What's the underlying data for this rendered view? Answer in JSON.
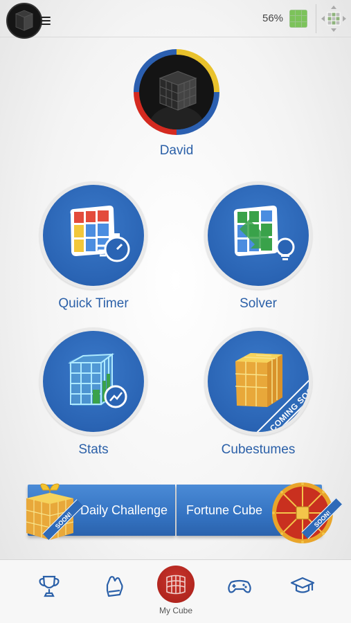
{
  "status": {
    "battery_percent": "56%"
  },
  "profile": {
    "name": "David"
  },
  "features": [
    {
      "label": "Quick Timer"
    },
    {
      "label": "Solver"
    },
    {
      "label": "Stats"
    },
    {
      "label": "Cubestumes",
      "ribbon": "COMING SOON!"
    }
  ],
  "challenges": {
    "daily": {
      "label": "Daily Challenge",
      "badge": "SOON!"
    },
    "fortune": {
      "label": "Fortune Cube",
      "badge": "SOON!"
    }
  },
  "tabs": [
    {
      "icon": "trophy-icon"
    },
    {
      "icon": "glove-icon"
    },
    {
      "icon": "cube-icon",
      "label": "My Cube",
      "active": true
    },
    {
      "icon": "gamepad-icon"
    },
    {
      "icon": "graduation-cap-icon"
    }
  ],
  "colors": {
    "accent_blue": "#2b60a8",
    "ring_yellow": "#e9c22c",
    "ring_red": "#d42a20",
    "active_tab_red": "#b3231c",
    "battery_green": "#7cc35a"
  }
}
